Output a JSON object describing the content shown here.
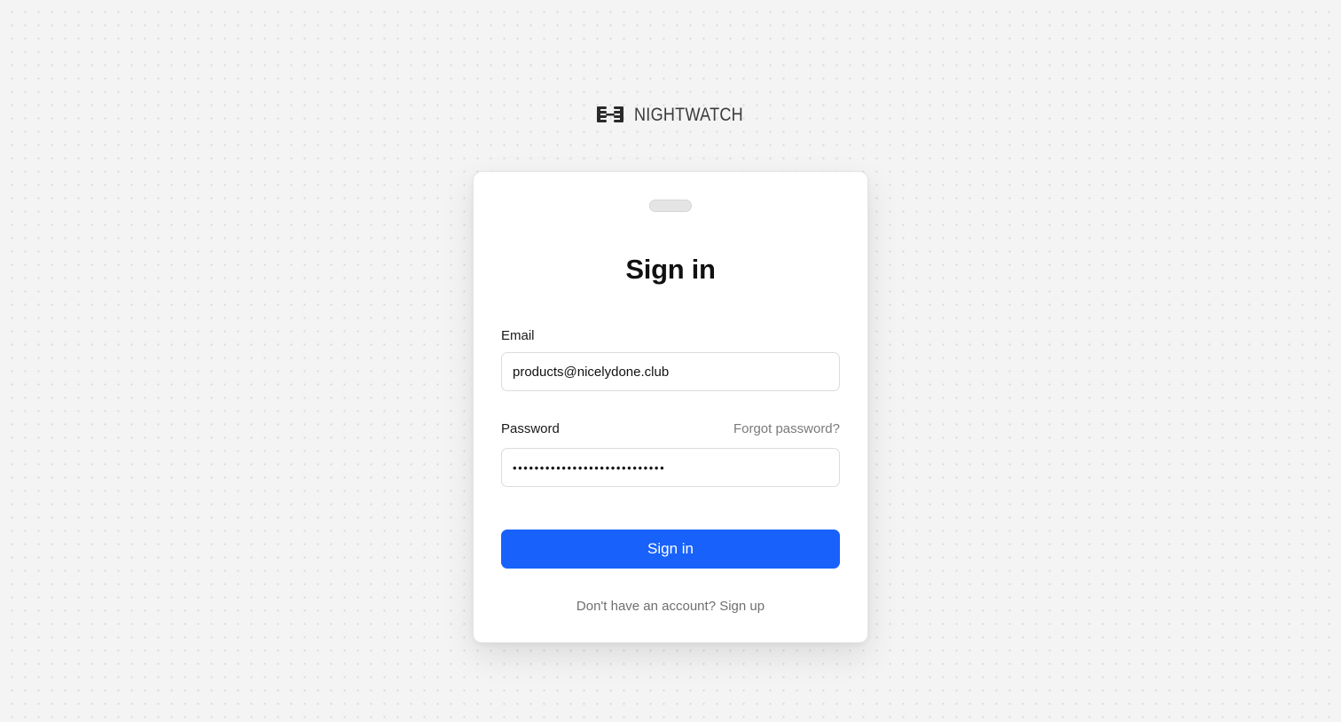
{
  "brand": {
    "name": "NIGHTWATCH",
    "logo_icon": "nightwatch-logo-icon"
  },
  "form": {
    "title": "Sign in",
    "email": {
      "label": "Email",
      "value": "products@nicelydone.club"
    },
    "password": {
      "label": "Password",
      "value": "••••••••••••••••••••••••••••",
      "forgot_label": "Forgot password?"
    },
    "submit_label": "Sign in",
    "signup": {
      "prompt": "Don't have an account?",
      "link_label": "Sign up"
    }
  },
  "colors": {
    "accent": "#1862fb",
    "background": "#f4f4f4",
    "card": "#ffffff"
  }
}
